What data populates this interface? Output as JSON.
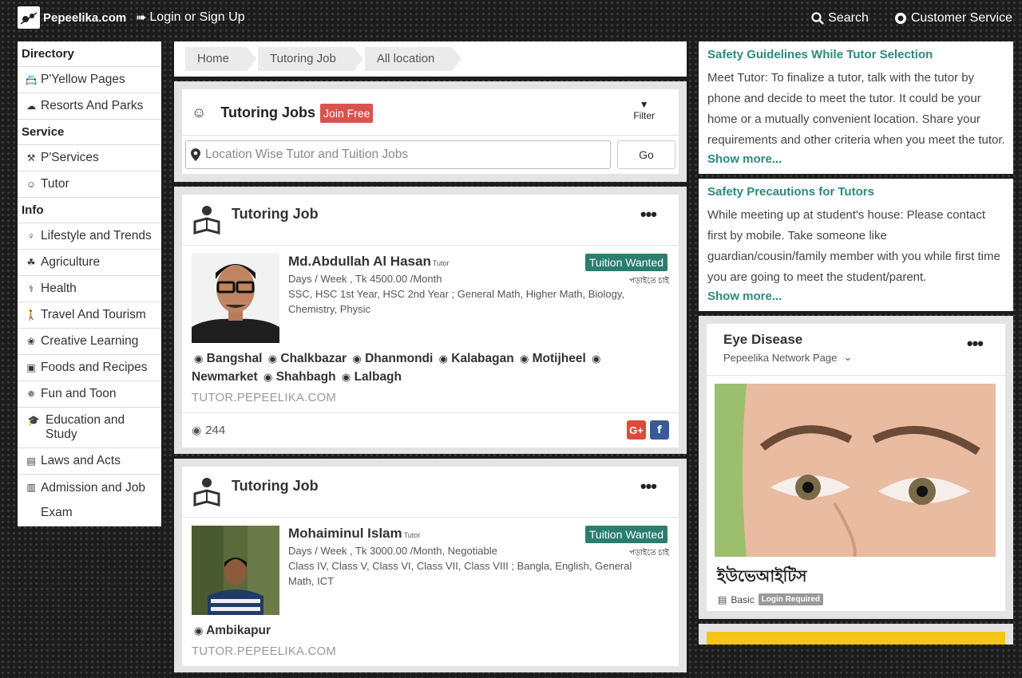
{
  "header": {
    "logo_text": "Pepeelika.com",
    "login": "Login or Sign Up",
    "search": "Search",
    "customer_service": "Customer Service"
  },
  "sidebar": {
    "sections": [
      {
        "title": "Directory",
        "items": [
          {
            "label": "P'Yellow Pages",
            "icon": "yellow-pages-icon"
          },
          {
            "label": "Resorts And Parks",
            "icon": "resort-icon"
          }
        ]
      },
      {
        "title": "Service",
        "items": [
          {
            "label": "P'Services",
            "icon": "services-icon"
          },
          {
            "label": "Tutor",
            "icon": "tutor-icon"
          }
        ]
      },
      {
        "title": "Info",
        "items": [
          {
            "label": "Lifestyle and Trends",
            "icon": "lifestyle-icon"
          },
          {
            "label": "Agriculture",
            "icon": "agriculture-icon"
          },
          {
            "label": "Health",
            "icon": "stethoscope-icon"
          },
          {
            "label": "Travel And Tourism",
            "icon": "hiker-icon"
          },
          {
            "label": "Creative Learning",
            "icon": "creative-icon"
          },
          {
            "label": "Foods and Recipes",
            "icon": "food-icon"
          },
          {
            "label": "Fun and Toon",
            "icon": "pinwheel-icon"
          },
          {
            "label": "Education and Study",
            "icon": "graduation-cap-icon"
          },
          {
            "label": "Laws and Acts",
            "icon": "law-icon"
          },
          {
            "label": "Admission and Job Exam",
            "icon": "admission-icon"
          }
        ]
      }
    ]
  },
  "breadcrumb": [
    "Home",
    "Tutoring Job",
    "All location"
  ],
  "jobs_panel": {
    "title": "Tutoring Jobs",
    "join": "Join Free",
    "filter": "Filter",
    "search_placeholder": "Location Wise Tutor and Tuition Jobs",
    "go": "Go"
  },
  "jobs": [
    {
      "header": "Tutoring Job",
      "name": "Md.Abdullah Al Hasan",
      "role": "Tutor",
      "badge": "Tuition Wanted",
      "badge_sub": "পড়াইতে চাই",
      "schedule": "Days / Week , Tk 4500.00 /Month",
      "subjects": "SSC, HSC 1st Year, HSC 2nd Year ; General Math, Higher Math, Biology, Chemistry, Physic",
      "locations": [
        "Bangshal",
        "Chalkbazar",
        "Dhanmondi",
        "Kalabagan",
        "Motijheel",
        "Newmarket",
        "Shahbagh",
        "Lalbagh"
      ],
      "url": "TUTOR.PEPEELIKA.COM",
      "views": "244"
    },
    {
      "header": "Tutoring Job",
      "name": "Mohaiminul Islam",
      "role": "Tutor",
      "badge": "Tuition Wanted",
      "badge_sub": "পড়াইতে চাই",
      "schedule": "Days / Week , Tk 3000.00 /Month, Negotiable",
      "subjects": "Class IV, Class V, Class VI, Class VII, Class VIII ; Bangla, English, General Math, ICT",
      "locations": [
        "Ambikapur"
      ],
      "url": "TUTOR.PEPEELIKA.COM"
    }
  ],
  "right": {
    "guidelines": {
      "title": "Safety Guidelines While Tutor Selection",
      "text": "Meet Tutor: To finalize a tutor, talk with the tutor by phone and decide to meet the tutor. It could be your home or a mutually convenient location. Share your requirements and other criteria when you meet the tutor.",
      "more": "Show more..."
    },
    "precautions": {
      "title": "Safety Precautions for Tutors",
      "text": "While meeting up at student's house: Please contact first by mobile. Take someone like guardian/cousin/family member with you while first time you are going to meet the student/parent.",
      "more": "Show more..."
    },
    "ad": {
      "title": "Eye Disease",
      "subtitle": "Pepeelika Network Page",
      "caption": "ইউভেআইটিস",
      "tier": "Basic",
      "login_required": "Login Required"
    }
  },
  "colors": {
    "accent": "#2b8a7d",
    "badge": "#2b7d6f",
    "join": "#d9534f"
  }
}
